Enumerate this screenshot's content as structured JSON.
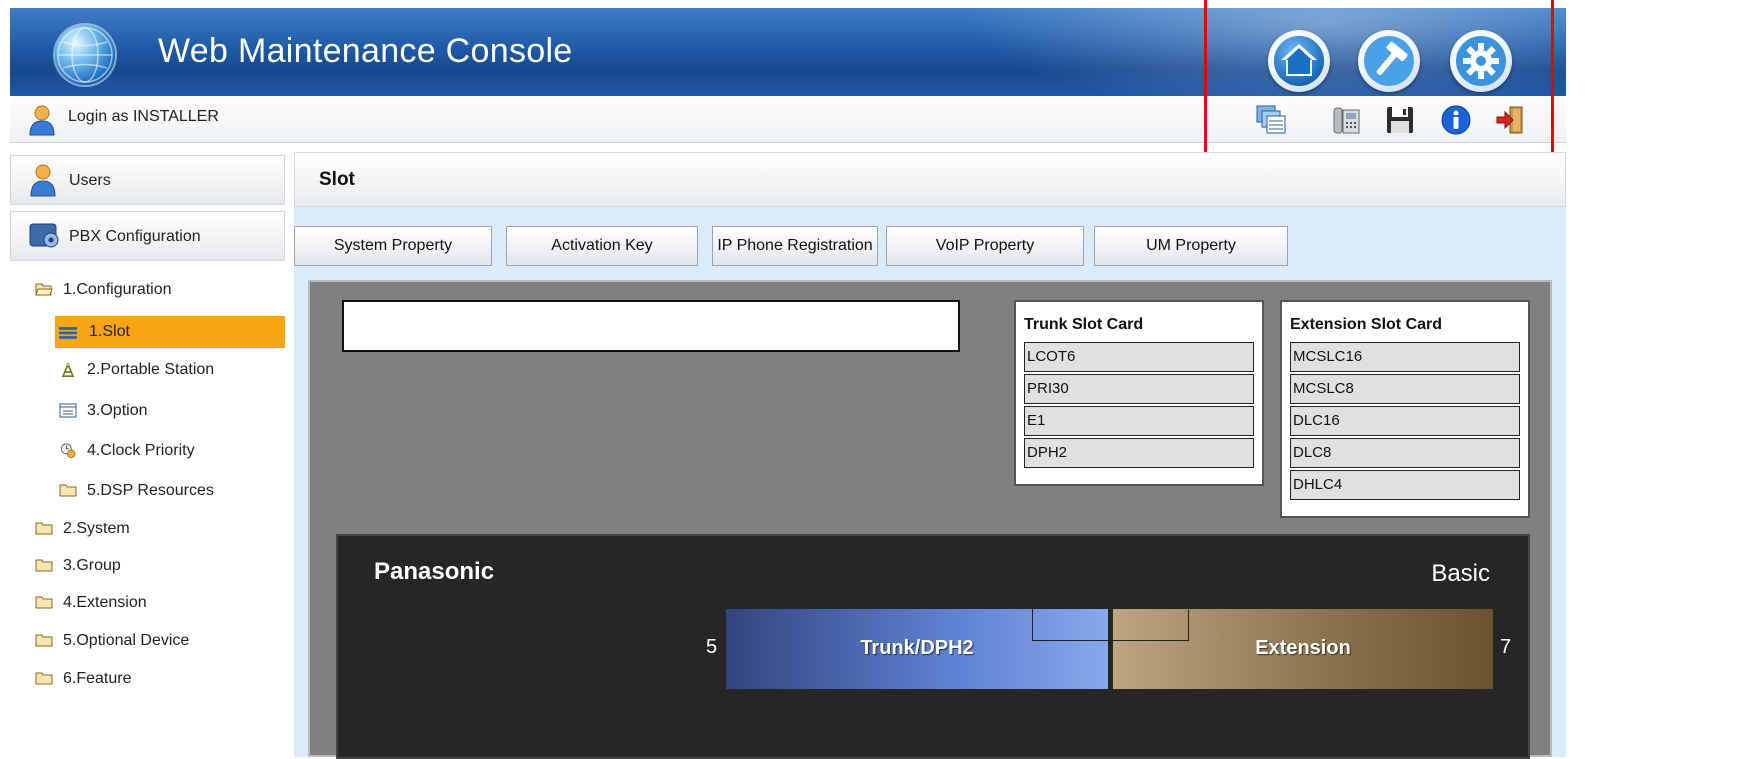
{
  "header": {
    "title": "Web Maintenance Console"
  },
  "header_buttons": [
    {
      "name": "home-icon"
    },
    {
      "name": "hammer-icon"
    },
    {
      "name": "gear-icon"
    }
  ],
  "login": {
    "text": "Login as INSTALLER"
  },
  "toolbar_icons": [
    "window-list-icon",
    "phone-icon",
    "save-icon",
    "info-icon",
    "logout-icon"
  ],
  "sidebar": {
    "users_label": "Users",
    "pbx_label": "PBX Configuration",
    "tree": [
      {
        "label": "1.Configuration",
        "icon": "folder-open-icon",
        "level": 0
      },
      {
        "label": "1.Slot",
        "icon": "slot-icon",
        "level": 1,
        "selected": true
      },
      {
        "label": "2.Portable Station",
        "icon": "antenna-icon",
        "level": 1
      },
      {
        "label": "3.Option",
        "icon": "option-icon",
        "level": 1
      },
      {
        "label": "4.Clock Priority",
        "icon": "clock-icon",
        "level": 1
      },
      {
        "label": "5.DSP Resources",
        "icon": "folder-icon",
        "level": 1
      },
      {
        "label": "2.System",
        "icon": "folder-icon",
        "level": 0
      },
      {
        "label": "3.Group",
        "icon": "folder-icon",
        "level": 0
      },
      {
        "label": "4.Extension",
        "icon": "folder-icon",
        "level": 0
      },
      {
        "label": "5.Optional Device",
        "icon": "folder-icon",
        "level": 0
      },
      {
        "label": "6.Feature",
        "icon": "folder-icon",
        "level": 0
      }
    ]
  },
  "main": {
    "page_title": "Slot",
    "tabs": [
      "System Property",
      "Activation Key",
      "IP Phone Registration",
      "VoIP Property",
      "UM Property"
    ],
    "trunk_cards": {
      "title": "Trunk Slot Card",
      "items": [
        "LCOT6",
        "PRI30",
        "E1",
        "DPH2"
      ]
    },
    "extension_cards": {
      "title": "Extension Slot Card",
      "items": [
        "MCSLC16",
        "MCSLC8",
        "DLC16",
        "DLC8",
        "DHLC4"
      ]
    },
    "device": {
      "brand": "Panasonic",
      "model": "Basic",
      "left_num": "5",
      "right_num": "7",
      "trunk_label": "Trunk/DPH2",
      "ext_label": "Extension"
    }
  },
  "colors": {
    "title_blue": "#1f5aa6",
    "selection_orange": "#f7a513",
    "highlight_red": "#e30613",
    "panel_gray": "#808080"
  }
}
